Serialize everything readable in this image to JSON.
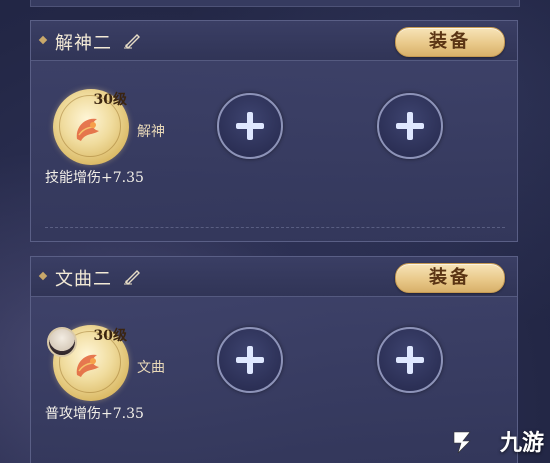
{
  "panels": [
    {
      "title": "解神二",
      "equip_label": "装备",
      "skill": {
        "level": "30级",
        "name": "解神",
        "bonus": "技能增伤+7.35",
        "has_avatar": false
      },
      "empty_slots": 2
    },
    {
      "title": "文曲二",
      "equip_label": "装备",
      "skill": {
        "level": "30级",
        "name": "文曲",
        "bonus": "普攻增伤+7.35",
        "has_avatar": true
      },
      "empty_slots": 2
    }
  ],
  "watermark": {
    "text": "九游"
  },
  "colors": {
    "panel_bg": "#3e4270",
    "equip_button": "#e9c98a",
    "equip_text": "#5a3414",
    "accent_gold": "#c9a86a"
  },
  "icons": [
    "edit-brush-icon",
    "plus-icon",
    "skill-emblem-icon",
    "avatar",
    "jiuyou-logo-icon"
  ]
}
